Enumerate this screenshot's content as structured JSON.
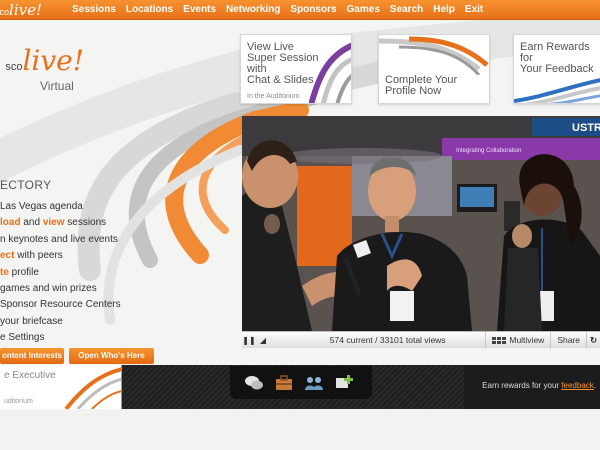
{
  "brand": {
    "prefix": "co",
    "name": "live!"
  },
  "nav": [
    "Sessions",
    "Locations",
    "Events",
    "Networking",
    "Sponsors",
    "Games",
    "Search",
    "Help",
    "Exit"
  ],
  "logo": {
    "prefix": "sco",
    "name": "live!",
    "sub": "Virtual"
  },
  "directory": {
    "title": "ECTORY",
    "items": [
      {
        "pre": "",
        "hl": "",
        "post": "Las Vegas agenda"
      },
      {
        "pre": "",
        "hl": "load",
        "mid": " and ",
        "hl2": "view",
        "post": " sessions"
      },
      {
        "pre": "",
        "hl": "",
        "post": "n keynotes and live events"
      },
      {
        "pre": "",
        "hl": "ect",
        "post": " with peers"
      },
      {
        "pre": "",
        "hl": "te",
        "post": " profile"
      },
      {
        "pre": "",
        "hl": "",
        "post": "games and win prizes"
      },
      {
        "pre": "",
        "hl": "",
        "post": "Sponsor Resource Centers"
      },
      {
        "pre": "",
        "hl": "",
        "post": "your briefcase"
      },
      {
        "pre": "",
        "hl": "",
        "post": "e Settings"
      }
    ]
  },
  "buttons": {
    "interests": "ontent Interests",
    "whos_here": "Open Who's Here"
  },
  "promos": [
    {
      "title": "View Live\nSuper Session\nwith\nChat & Slides",
      "sub": "In the Auditorium"
    },
    {
      "title": "Complete Your\nProfile Now",
      "sub": ""
    },
    {
      "title": "Earn Rewards for\nYour Feedback",
      "sub": ""
    }
  ],
  "video": {
    "views": "574 current / 33101 total views",
    "multiview": "Multiview",
    "share": "Share",
    "sign": "USTRE",
    "banner": "Integrating Collaboration"
  },
  "band": {
    "left_title": "e Executive",
    "left_sub": "uditorium",
    "right_text": "Earn rewards for your ",
    "right_link": "feedback",
    "right_end": "."
  },
  "colors": {
    "accent": "#e8701a",
    "dark": "#242424"
  },
  "icons": [
    "chat-bubbles-icon",
    "briefcase-icon",
    "people-icon",
    "add-contact-icon"
  ]
}
